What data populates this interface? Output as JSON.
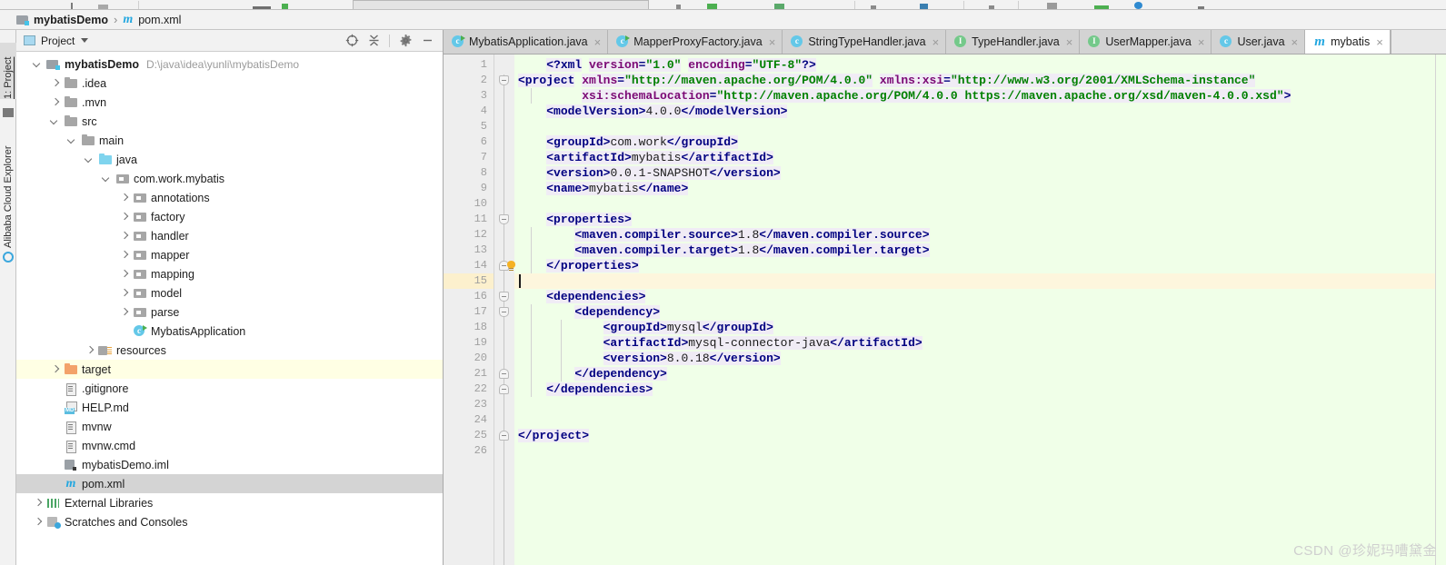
{
  "toolbar": {
    "visible": "partially-cropped-icon-row"
  },
  "breadcrumb": {
    "project_name": "mybatisDemo",
    "separator": "›",
    "file_marker": "m",
    "file_name": "pom.xml"
  },
  "left_strip": {
    "items": [
      {
        "label": "1: Project",
        "active": true
      },
      {
        "label": "Alibaba Cloud Explorer",
        "active": false
      }
    ]
  },
  "project_panel": {
    "title": "Project",
    "caret": "▾",
    "tools": [
      {
        "name": "locate-icon",
        "glyph": "⊕"
      },
      {
        "name": "collapse-all-icon",
        "glyph": "≡"
      },
      {
        "name": "settings-gear-icon",
        "glyph": "⚙"
      },
      {
        "name": "hide-panel-icon",
        "glyph": "—"
      }
    ],
    "tree": [
      {
        "depth": 0,
        "arrow": "down",
        "icon": "module-root",
        "label": "mybatisDemo",
        "bold": true,
        "path": "D:\\java\\idea\\yunli\\mybatisDemo",
        "state": "none"
      },
      {
        "depth": 1,
        "arrow": "right",
        "icon": "folder",
        "label": ".idea",
        "bold": false,
        "path": "",
        "state": "none"
      },
      {
        "depth": 1,
        "arrow": "right",
        "icon": "folder",
        "label": ".mvn",
        "bold": false,
        "path": "",
        "state": "none"
      },
      {
        "depth": 1,
        "arrow": "down",
        "icon": "folder",
        "label": "src",
        "bold": false,
        "path": "",
        "state": "none"
      },
      {
        "depth": 2,
        "arrow": "down",
        "icon": "folder",
        "label": "main",
        "bold": false,
        "path": "",
        "state": "none"
      },
      {
        "depth": 3,
        "arrow": "down",
        "icon": "folder-blue",
        "label": "java",
        "bold": false,
        "path": "",
        "state": "none"
      },
      {
        "depth": 4,
        "arrow": "down",
        "icon": "package",
        "label": "com.work.mybatis",
        "bold": false,
        "path": "",
        "state": "none"
      },
      {
        "depth": 5,
        "arrow": "right",
        "icon": "package",
        "label": "annotations",
        "bold": false,
        "path": "",
        "state": "none"
      },
      {
        "depth": 5,
        "arrow": "right",
        "icon": "package",
        "label": "factory",
        "bold": false,
        "path": "",
        "state": "none"
      },
      {
        "depth": 5,
        "arrow": "right",
        "icon": "package",
        "label": "handler",
        "bold": false,
        "path": "",
        "state": "none"
      },
      {
        "depth": 5,
        "arrow": "right",
        "icon": "package",
        "label": "mapper",
        "bold": false,
        "path": "",
        "state": "none"
      },
      {
        "depth": 5,
        "arrow": "right",
        "icon": "package",
        "label": "mapping",
        "bold": false,
        "path": "",
        "state": "none"
      },
      {
        "depth": 5,
        "arrow": "right",
        "icon": "package",
        "label": "model",
        "bold": false,
        "path": "",
        "state": "none"
      },
      {
        "depth": 5,
        "arrow": "right",
        "icon": "package",
        "label": "parse",
        "bold": false,
        "path": "",
        "state": "none"
      },
      {
        "depth": 5,
        "arrow": "none",
        "icon": "java-class-runnable",
        "label": "MybatisApplication",
        "bold": false,
        "path": "",
        "state": "none"
      },
      {
        "depth": 3,
        "arrow": "right",
        "icon": "resources",
        "label": "resources",
        "bold": false,
        "path": "",
        "state": "none"
      },
      {
        "depth": 1,
        "arrow": "right",
        "icon": "folder-orange",
        "label": "target",
        "bold": false,
        "path": "",
        "state": "highlight-yellow"
      },
      {
        "depth": 1,
        "arrow": "none",
        "icon": "text-file",
        "label": ".gitignore",
        "bold": false,
        "path": "",
        "state": "none"
      },
      {
        "depth": 1,
        "arrow": "none",
        "icon": "markdown",
        "label": "HELP.md",
        "bold": false,
        "path": "",
        "state": "none"
      },
      {
        "depth": 1,
        "arrow": "none",
        "icon": "text-file",
        "label": "mvnw",
        "bold": false,
        "path": "",
        "state": "none"
      },
      {
        "depth": 1,
        "arrow": "none",
        "icon": "text-file",
        "label": "mvnw.cmd",
        "bold": false,
        "path": "",
        "state": "none"
      },
      {
        "depth": 1,
        "arrow": "none",
        "icon": "iml-file",
        "label": "mybatisDemo.iml",
        "bold": false,
        "path": "",
        "state": "none"
      },
      {
        "depth": 1,
        "arrow": "none",
        "icon": "maven-file",
        "label": "pom.xml",
        "bold": false,
        "path": "",
        "state": "selected-gray"
      },
      {
        "depth": 0,
        "arrow": "right",
        "icon": "libraries",
        "label": "External Libraries",
        "bold": false,
        "path": "",
        "state": "none"
      },
      {
        "depth": 0,
        "arrow": "right",
        "icon": "scratches",
        "label": "Scratches and Consoles",
        "bold": false,
        "path": "",
        "state": "none"
      }
    ]
  },
  "editor": {
    "tabs": [
      {
        "label": "MybatisApplication.java",
        "icon": "java-class-runnable",
        "active": false,
        "close": "×"
      },
      {
        "label": "MapperProxyFactory.java",
        "icon": "java-class-runnable",
        "active": false,
        "close": "×"
      },
      {
        "label": "StringTypeHandler.java",
        "icon": "java-class",
        "active": false,
        "close": "×"
      },
      {
        "label": "TypeHandler.java",
        "icon": "java-interface",
        "active": false,
        "close": "×"
      },
      {
        "label": "UserMapper.java",
        "icon": "java-interface",
        "active": false,
        "close": "×"
      },
      {
        "label": "User.java",
        "icon": "java-class",
        "active": false,
        "close": "×"
      },
      {
        "label": "mybatis",
        "icon": "maven-file",
        "active": true,
        "close": "×"
      }
    ],
    "line_numbers": [
      1,
      2,
      3,
      4,
      5,
      6,
      7,
      8,
      9,
      10,
      11,
      12,
      13,
      14,
      15,
      16,
      17,
      18,
      19,
      20,
      21,
      22,
      23,
      24,
      25,
      26
    ],
    "current_line": 15,
    "code_lines": [
      {
        "n": 1,
        "tokens": [
          {
            "t": "    ",
            "c": "txtv"
          },
          {
            "t": "<?",
            "c": "punc"
          },
          {
            "t": "xml",
            "c": "tag"
          },
          {
            "t": " ",
            "c": "txtv"
          },
          {
            "t": "version",
            "c": "attr"
          },
          {
            "t": "=",
            "c": "punc"
          },
          {
            "t": "\"1.0\"",
            "c": "val"
          },
          {
            "t": " ",
            "c": "txtv"
          },
          {
            "t": "encoding",
            "c": "attr"
          },
          {
            "t": "=",
            "c": "punc"
          },
          {
            "t": "\"UTF-8\"",
            "c": "val"
          },
          {
            "t": "?>",
            "c": "punc"
          }
        ]
      },
      {
        "n": 2,
        "tokens": [
          {
            "t": "<project",
            "c": "tag"
          },
          {
            "t": " ",
            "c": "txtv"
          },
          {
            "t": "xmlns",
            "c": "attr"
          },
          {
            "t": "=",
            "c": "punc"
          },
          {
            "t": "\"http://maven.apache.org/POM/4.0.0\"",
            "c": "val"
          },
          {
            "t": " ",
            "c": "txtv"
          },
          {
            "t": "xmlns:xsi",
            "c": "attr"
          },
          {
            "t": "=",
            "c": "punc"
          },
          {
            "t": "\"http://www.w3.org/2001/XMLSchema-instance\"",
            "c": "val"
          }
        ]
      },
      {
        "n": 3,
        "tokens": [
          {
            "t": "         ",
            "c": "txtv"
          },
          {
            "t": "xsi:schemaLocation",
            "c": "attr"
          },
          {
            "t": "=",
            "c": "punc"
          },
          {
            "t": "\"http://maven.apache.org/POM/4.0.0 https://maven.apache.org/xsd/maven-4.0.0.xsd\"",
            "c": "val"
          },
          {
            "t": ">",
            "c": "punc"
          }
        ]
      },
      {
        "n": 4,
        "tokens": [
          {
            "t": "    ",
            "c": "txtv"
          },
          {
            "t": "<modelVersion>",
            "c": "tag"
          },
          {
            "t": "4.0.0",
            "c": "txtv"
          },
          {
            "t": "</modelVersion>",
            "c": "tag"
          }
        ]
      },
      {
        "n": 5,
        "tokens": []
      },
      {
        "n": 6,
        "tokens": [
          {
            "t": "    ",
            "c": "txtv"
          },
          {
            "t": "<groupId>",
            "c": "tag"
          },
          {
            "t": "com.work",
            "c": "txtv"
          },
          {
            "t": "</groupId>",
            "c": "tag"
          }
        ]
      },
      {
        "n": 7,
        "tokens": [
          {
            "t": "    ",
            "c": "txtv"
          },
          {
            "t": "<artifactId>",
            "c": "tag"
          },
          {
            "t": "mybatis",
            "c": "txtv"
          },
          {
            "t": "</artifactId>",
            "c": "tag"
          }
        ]
      },
      {
        "n": 8,
        "tokens": [
          {
            "t": "    ",
            "c": "txtv"
          },
          {
            "t": "<version>",
            "c": "tag"
          },
          {
            "t": "0.0.1-SNAPSHOT",
            "c": "txtv"
          },
          {
            "t": "</version>",
            "c": "tag"
          }
        ]
      },
      {
        "n": 9,
        "tokens": [
          {
            "t": "    ",
            "c": "txtv"
          },
          {
            "t": "<name>",
            "c": "tag"
          },
          {
            "t": "mybatis",
            "c": "txtv"
          },
          {
            "t": "</name>",
            "c": "tag"
          }
        ]
      },
      {
        "n": 10,
        "tokens": []
      },
      {
        "n": 11,
        "tokens": [
          {
            "t": "    ",
            "c": "txtv"
          },
          {
            "t": "<properties>",
            "c": "tag"
          }
        ]
      },
      {
        "n": 12,
        "tokens": [
          {
            "t": "        ",
            "c": "txtv"
          },
          {
            "t": "<maven.compiler.source>",
            "c": "tag"
          },
          {
            "t": "1.8",
            "c": "txtv"
          },
          {
            "t": "</maven.compiler.source>",
            "c": "tag"
          }
        ]
      },
      {
        "n": 13,
        "tokens": [
          {
            "t": "        ",
            "c": "txtv"
          },
          {
            "t": "<maven.compiler.target>",
            "c": "tag"
          },
          {
            "t": "1.8",
            "c": "txtv"
          },
          {
            "t": "</maven.compiler.target>",
            "c": "tag"
          }
        ]
      },
      {
        "n": 14,
        "tokens": [
          {
            "t": "    ",
            "c": "txtv"
          },
          {
            "t": "</properties>",
            "c": "tag"
          }
        ]
      },
      {
        "n": 15,
        "tokens": []
      },
      {
        "n": 16,
        "tokens": [
          {
            "t": "    ",
            "c": "txtv"
          },
          {
            "t": "<dependencies>",
            "c": "tag"
          }
        ]
      },
      {
        "n": 17,
        "tokens": [
          {
            "t": "        ",
            "c": "txtv"
          },
          {
            "t": "<dependency>",
            "c": "tag"
          }
        ]
      },
      {
        "n": 18,
        "tokens": [
          {
            "t": "            ",
            "c": "txtv"
          },
          {
            "t": "<groupId>",
            "c": "tag"
          },
          {
            "t": "mysql",
            "c": "txtv"
          },
          {
            "t": "</groupId>",
            "c": "tag"
          }
        ]
      },
      {
        "n": 19,
        "tokens": [
          {
            "t": "            ",
            "c": "txtv"
          },
          {
            "t": "<artifactId>",
            "c": "tag"
          },
          {
            "t": "mysql-connector-java",
            "c": "txtv"
          },
          {
            "t": "</artifactId>",
            "c": "tag"
          }
        ]
      },
      {
        "n": 20,
        "tokens": [
          {
            "t": "            ",
            "c": "txtv"
          },
          {
            "t": "<version>",
            "c": "tag"
          },
          {
            "t": "8.0.18",
            "c": "txtv"
          },
          {
            "t": "</version>",
            "c": "tag"
          }
        ]
      },
      {
        "n": 21,
        "tokens": [
          {
            "t": "        ",
            "c": "txtv"
          },
          {
            "t": "</dependency>",
            "c": "tag"
          }
        ]
      },
      {
        "n": 22,
        "tokens": [
          {
            "t": "    ",
            "c": "txtv"
          },
          {
            "t": "</dependencies>",
            "c": "tag"
          }
        ]
      },
      {
        "n": 23,
        "tokens": []
      },
      {
        "n": 24,
        "tokens": []
      },
      {
        "n": 25,
        "tokens": [
          {
            "t": "</project>",
            "c": "tag"
          }
        ]
      },
      {
        "n": 26,
        "tokens": []
      }
    ],
    "fold_markers": [
      {
        "line": 2,
        "type": "open"
      },
      {
        "line": 11,
        "type": "open"
      },
      {
        "line": 14,
        "type": "close"
      },
      {
        "line": 16,
        "type": "open"
      },
      {
        "line": 17,
        "type": "open"
      },
      {
        "line": 21,
        "type": "close"
      },
      {
        "line": 22,
        "type": "close"
      },
      {
        "line": 25,
        "type": "close"
      }
    ],
    "intention_bulb": {
      "line": 14,
      "name": "intention-bulb-icon"
    }
  },
  "watermark": "CSDN @珍妮玛嘈黛金",
  "colors": {
    "editor_bg": "#f0ffe8",
    "gutter_bg": "#eeeeee",
    "current_line": "#fdf6dd",
    "tab_active": "#ffffff",
    "tab_inactive": "#d3d3d3",
    "tree_selection": "#d4d4d4",
    "tree_highlight": "#ffffe4",
    "tag_color": "#000080",
    "attr_color": "#7a0874",
    "value_color": "#008000"
  }
}
